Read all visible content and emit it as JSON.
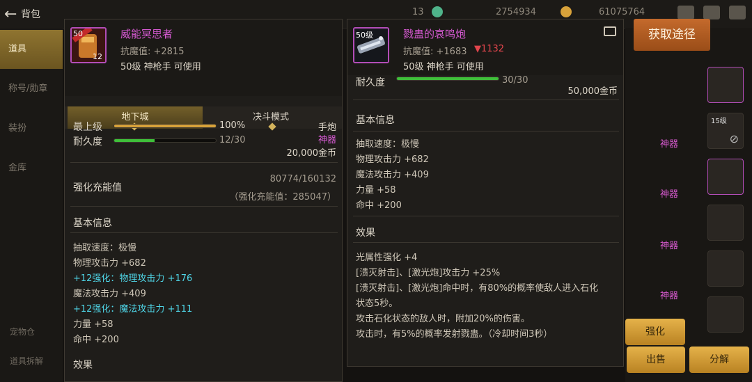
{
  "topbar": {
    "title": "背包",
    "currency_1": "13",
    "currency_2": "2754934",
    "currency_3": "61075764"
  },
  "leftnav": {
    "items": [
      "道具",
      "称号/勋章",
      "装扮",
      "金库"
    ],
    "footer": [
      "宠物仓",
      "道具拆解"
    ]
  },
  "obtain_button": "获取途径",
  "right_panel": {
    "rarity_labels": [
      "神器",
      "神器",
      "神器",
      "神器"
    ],
    "buttons": [
      "出售",
      "分解"
    ],
    "slot_label": "15级",
    "partial_button": "强化"
  },
  "left_item": {
    "level": "50",
    "name": "威能冥思者",
    "resist": "抗魔值: +2815",
    "req": "50级 神枪手 可使用",
    "tabs": [
      "地下城",
      "决斗模式"
    ],
    "max_level_label": "最上级",
    "max_level_value": "100%",
    "durability_label": "耐久度",
    "durability_value": "12/30",
    "type": "手炮",
    "rarity": "神器",
    "price": "20,000金币",
    "charge_label": "强化充能值",
    "charge_value": "80774/160132",
    "charge_sub": "（强化充能值：285047）",
    "basic_title": "基本信息",
    "stats": [
      "抽取速度：极慢",
      "物理攻击力 +682",
      "+12强化：物理攻击力 +176",
      "魔法攻击力 +409",
      "+12强化：魔法攻击力 +111",
      "力量 +58",
      "命中 +200"
    ],
    "bottom_partial": "效果"
  },
  "right_item": {
    "level": "50级",
    "name": "戮蛊的哀鸣炮",
    "resist": "抗魔值: +1683",
    "resist_diff": "▼1132",
    "req": "50级 神枪手 可使用",
    "durability_label": "耐久度",
    "durability_value": "30/30",
    "price": "50,000金币",
    "basic_title": "基本信息",
    "stats": [
      "抽取速度：极慢",
      "物理攻击力 +682",
      "魔法攻击力 +409",
      "力量 +58",
      "命中 +200"
    ],
    "effect_title": "效果",
    "effects": [
      "光属性强化 +4",
      "[溃灭射击]、[激光炮]攻击力 +25%",
      "[溃灭射击]、[激光炮]命中时，有80%的概率使敌人进入石化",
      "状态5秒。",
      "攻击石化状态的敌人时，附加20%的伤害。",
      "攻击时，有5%的概率发射戮蛊。（冷却时间3秒）"
    ]
  },
  "progress": {
    "max_level": 1.0,
    "left_durability": 0.4,
    "right_durability": 1.0
  }
}
